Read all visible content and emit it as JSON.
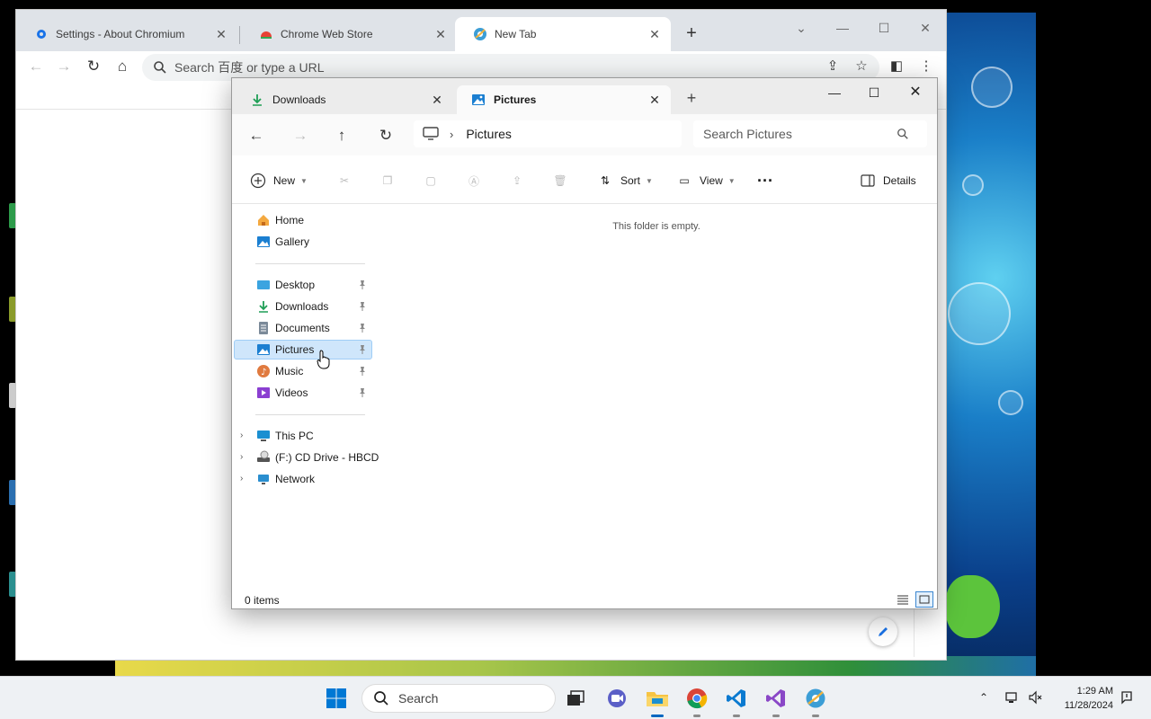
{
  "browser": {
    "tabs": [
      {
        "title": "Settings - About Chromium",
        "icon": "gear-icon"
      },
      {
        "title": "Chrome Web Store",
        "icon": "web-store-icon"
      },
      {
        "title": "New Tab",
        "icon": "chromium-icon",
        "active": true
      }
    ],
    "omnibox_placeholder": "Search 百度 or type a URL"
  },
  "explorer": {
    "tabs": [
      {
        "title": "Downloads",
        "icon": "download-icon"
      },
      {
        "title": "Pictures",
        "icon": "pictures-icon",
        "active": true
      }
    ],
    "address": {
      "location": "Pictures"
    },
    "search_placeholder": "Search Pictures",
    "commands": {
      "new": "New",
      "sort": "Sort",
      "view": "View",
      "details": "Details"
    },
    "nav": {
      "home": "Home",
      "gallery": "Gallery",
      "quick_access": [
        {
          "label": "Desktop",
          "pinned": true
        },
        {
          "label": "Downloads",
          "pinned": true
        },
        {
          "label": "Documents",
          "pinned": true
        },
        {
          "label": "Pictures",
          "pinned": true,
          "selected": true
        },
        {
          "label": "Music",
          "pinned": true
        },
        {
          "label": "Videos",
          "pinned": true
        }
      ],
      "drives": [
        {
          "label": "This PC"
        },
        {
          "label": "(F:) CD Drive - HBCD"
        },
        {
          "label": "Network"
        }
      ]
    },
    "empty_message": "This folder is empty.",
    "status": {
      "item_count": "0 items"
    }
  },
  "taskbar": {
    "search_label": "Search",
    "apps": [
      "task-view",
      "teams-meet",
      "file-explorer",
      "chromium",
      "vs-code",
      "visual-studio",
      "edge-like-browser"
    ],
    "active_app": "file-explorer",
    "clock": {
      "time": "1:29 AM",
      "date": "11/28/2024"
    }
  },
  "colors": {
    "accent": "#0067c0",
    "selection": "#cfe6fb"
  }
}
